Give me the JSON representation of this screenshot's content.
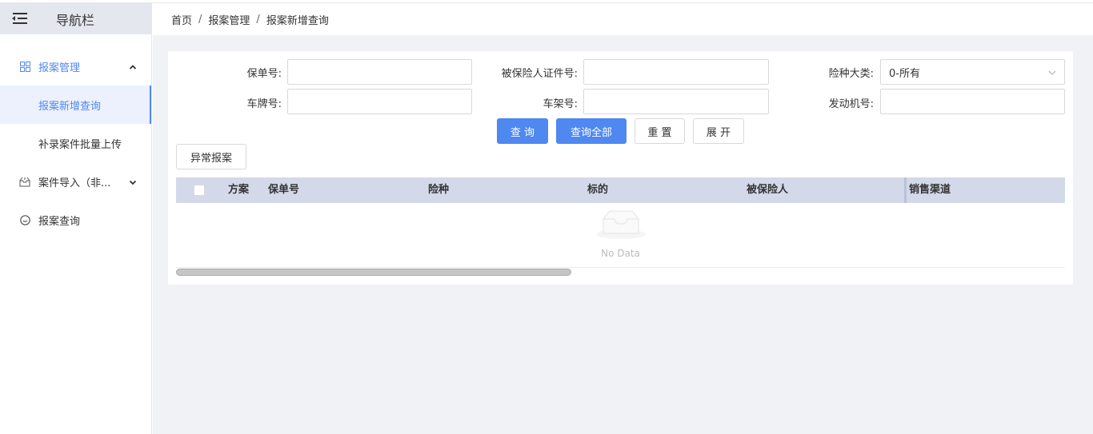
{
  "sidebar": {
    "title": "导航栏",
    "menu": [
      {
        "label": "报案管理",
        "icon": "grid-icon",
        "expanded": true,
        "sub": [
          {
            "label": "报案新增查询",
            "active": true
          },
          {
            "label": "补录案件批量上传",
            "active": false
          }
        ]
      },
      {
        "label": "案件导入（非...",
        "icon": "inbox-icon",
        "expanded": false
      },
      {
        "label": "报案查询",
        "icon": "smile-circle-icon"
      }
    ]
  },
  "breadcrumb": [
    "首页",
    "报案管理",
    "报案新增查询"
  ],
  "breadcrumb_sep": "/",
  "form": {
    "policy_no_label": "保单号:",
    "insured_id_label": "被保险人证件号:",
    "insurance_type_label": "险种大类:",
    "insurance_type_value": "0-所有",
    "plate_no_label": "车牌号:",
    "frame_no_label": "车架号:",
    "engine_no_label": "发动机号:"
  },
  "buttons": {
    "query": "查 询",
    "query_all": "查询全部",
    "reset": "重 置",
    "expand": "展 开",
    "abnormal_report": "异常报案"
  },
  "table": {
    "columns": [
      "方案",
      "保单号",
      "险种",
      "标的",
      "被保险人",
      "销售渠道"
    ],
    "empty_text": "No Data"
  },
  "colors": {
    "primary": "#4f88f0",
    "header_bg": "#d3d9e9",
    "content_bg": "#f0f2f5"
  }
}
